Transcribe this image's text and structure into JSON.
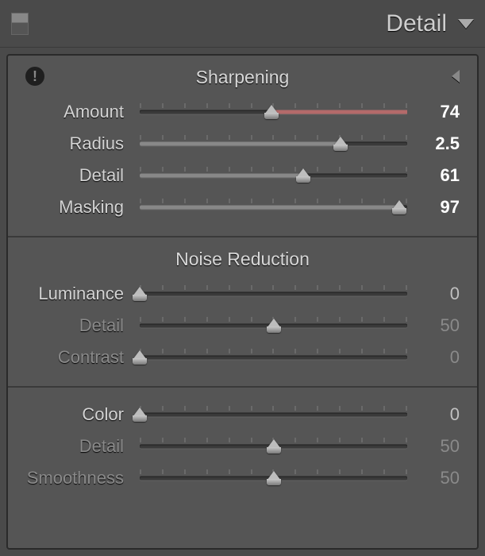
{
  "panel_title": "Detail",
  "sections": {
    "sharpening": {
      "title": "Sharpening",
      "sliders": {
        "amount": {
          "label": "Amount",
          "value": 74,
          "display": "74",
          "min": 0,
          "max": 150,
          "active": true
        },
        "radius": {
          "label": "Radius",
          "value": 2.5,
          "display": "2.5",
          "min": 0,
          "max": 3,
          "active": true
        },
        "detail": {
          "label": "Detail",
          "value": 61,
          "display": "61",
          "min": 0,
          "max": 100,
          "active": true
        },
        "masking": {
          "label": "Masking",
          "value": 97,
          "display": "97",
          "min": 0,
          "max": 100,
          "active": true
        }
      }
    },
    "noise_luma": {
      "title": "Noise Reduction",
      "sliders": {
        "luminance": {
          "label": "Luminance",
          "value": 0,
          "display": "0",
          "min": 0,
          "max": 100,
          "active": true,
          "disabled": false
        },
        "detail": {
          "label": "Detail",
          "value": 50,
          "display": "50",
          "min": 0,
          "max": 100,
          "active": false,
          "disabled": true
        },
        "contrast": {
          "label": "Contrast",
          "value": 0,
          "display": "0",
          "min": 0,
          "max": 100,
          "active": false,
          "disabled": true
        }
      }
    },
    "noise_color": {
      "sliders": {
        "color": {
          "label": "Color",
          "value": 0,
          "display": "0",
          "min": 0,
          "max": 100,
          "active": true,
          "disabled": false
        },
        "detail": {
          "label": "Detail",
          "value": 50,
          "display": "50",
          "min": 0,
          "max": 100,
          "active": false,
          "disabled": true
        },
        "smoothness": {
          "label": "Smoothness",
          "value": 50,
          "display": "50",
          "min": 0,
          "max": 100,
          "active": false,
          "disabled": true
        }
      }
    }
  }
}
